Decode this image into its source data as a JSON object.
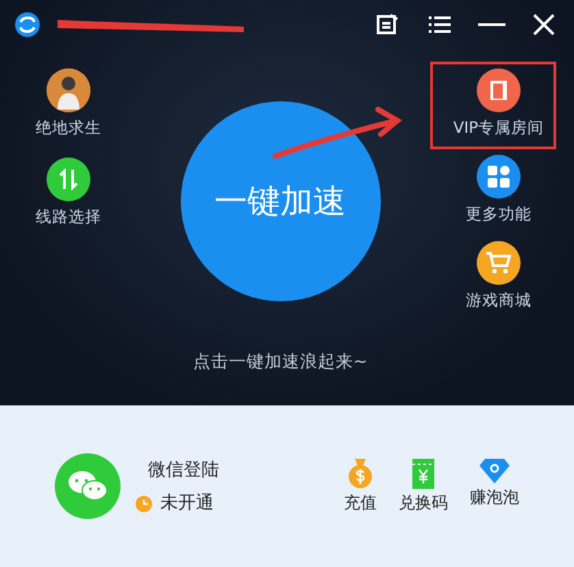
{
  "window": {
    "controls": [
      {
        "kind": "notes"
      },
      {
        "kind": "menu"
      },
      {
        "kind": "minimize"
      },
      {
        "kind": "close"
      }
    ]
  },
  "left_items": [
    {
      "label": "绝地求生",
      "kind": "game"
    },
    {
      "label": "线路选择",
      "kind": "route"
    }
  ],
  "boost_button": {
    "label": "一键加速"
  },
  "right_items": [
    {
      "label": "VIP专属房间",
      "kind": "vip",
      "highlighted": true
    },
    {
      "label": "更多功能",
      "kind": "more",
      "highlighted": false
    },
    {
      "label": "游戏商城",
      "kind": "shop",
      "highlighted": false
    }
  ],
  "hint": "点击一键加速浪起来~",
  "account": {
    "login": "微信登陆",
    "status": "未开通"
  },
  "actions": [
    {
      "label": "充值",
      "kind": "recharge"
    },
    {
      "label": "兑换码",
      "kind": "code"
    },
    {
      "label": "赚泡泡",
      "kind": "earn"
    }
  ]
}
